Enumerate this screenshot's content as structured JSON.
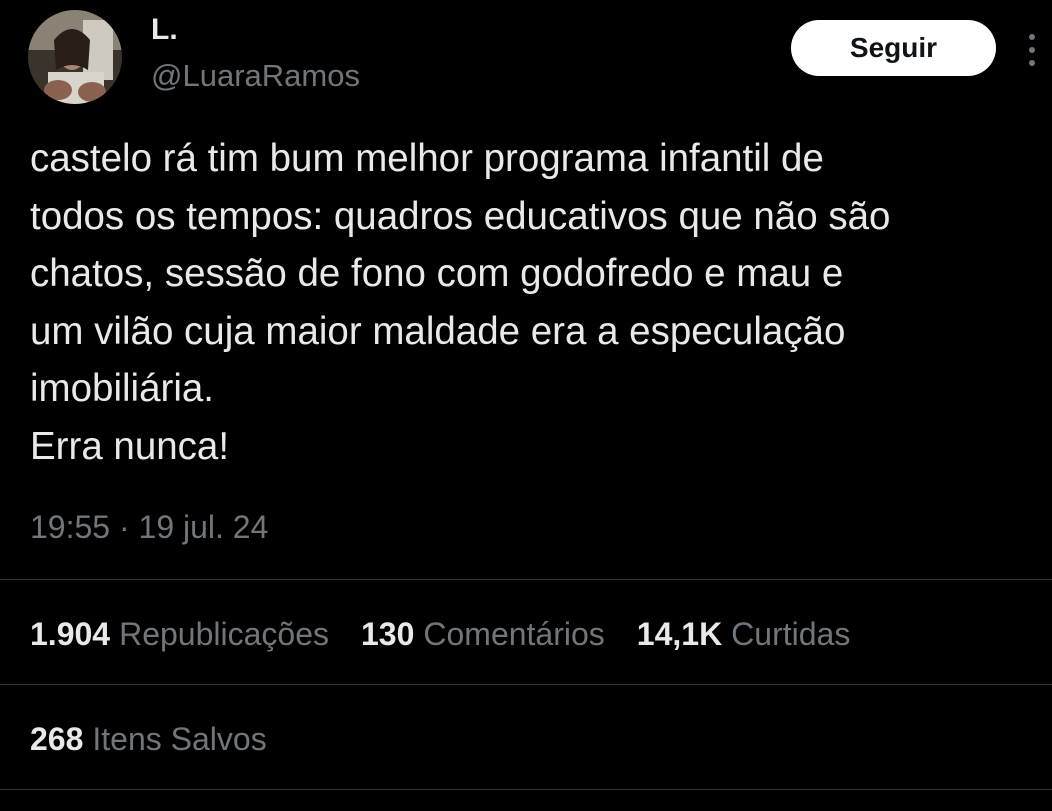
{
  "author": {
    "name": "L.",
    "handle": "@LuaraRamos"
  },
  "actions": {
    "follow_label": "Seguir",
    "more_icon": "more-vertical-icon"
  },
  "tweet": {
    "text": "castelo rá tim bum melhor programa infantil de\ntodos os tempos: quadros educativos que não são\nchatos, sessão de fono com godofredo e mau e\num vilão cuja maior maldade era a especulação\nimobiliária.\nErra nunca!",
    "time": "19:55",
    "separator": "·",
    "date": "19 jul. 24"
  },
  "stats": {
    "reposts": {
      "value": "1.904",
      "label": "Republicações"
    },
    "comments": {
      "value": "130",
      "label": "Comentários"
    },
    "likes": {
      "value": "14,1K",
      "label": "Curtidas"
    },
    "saves": {
      "value": "268",
      "label": "Itens Salvos"
    }
  },
  "colors": {
    "background": "#000000",
    "primary_text": "#e7e9ea",
    "secondary_text": "#71767b",
    "divider": "#2f3336",
    "button_bg": "#ffffff",
    "button_text": "#0f1419"
  }
}
